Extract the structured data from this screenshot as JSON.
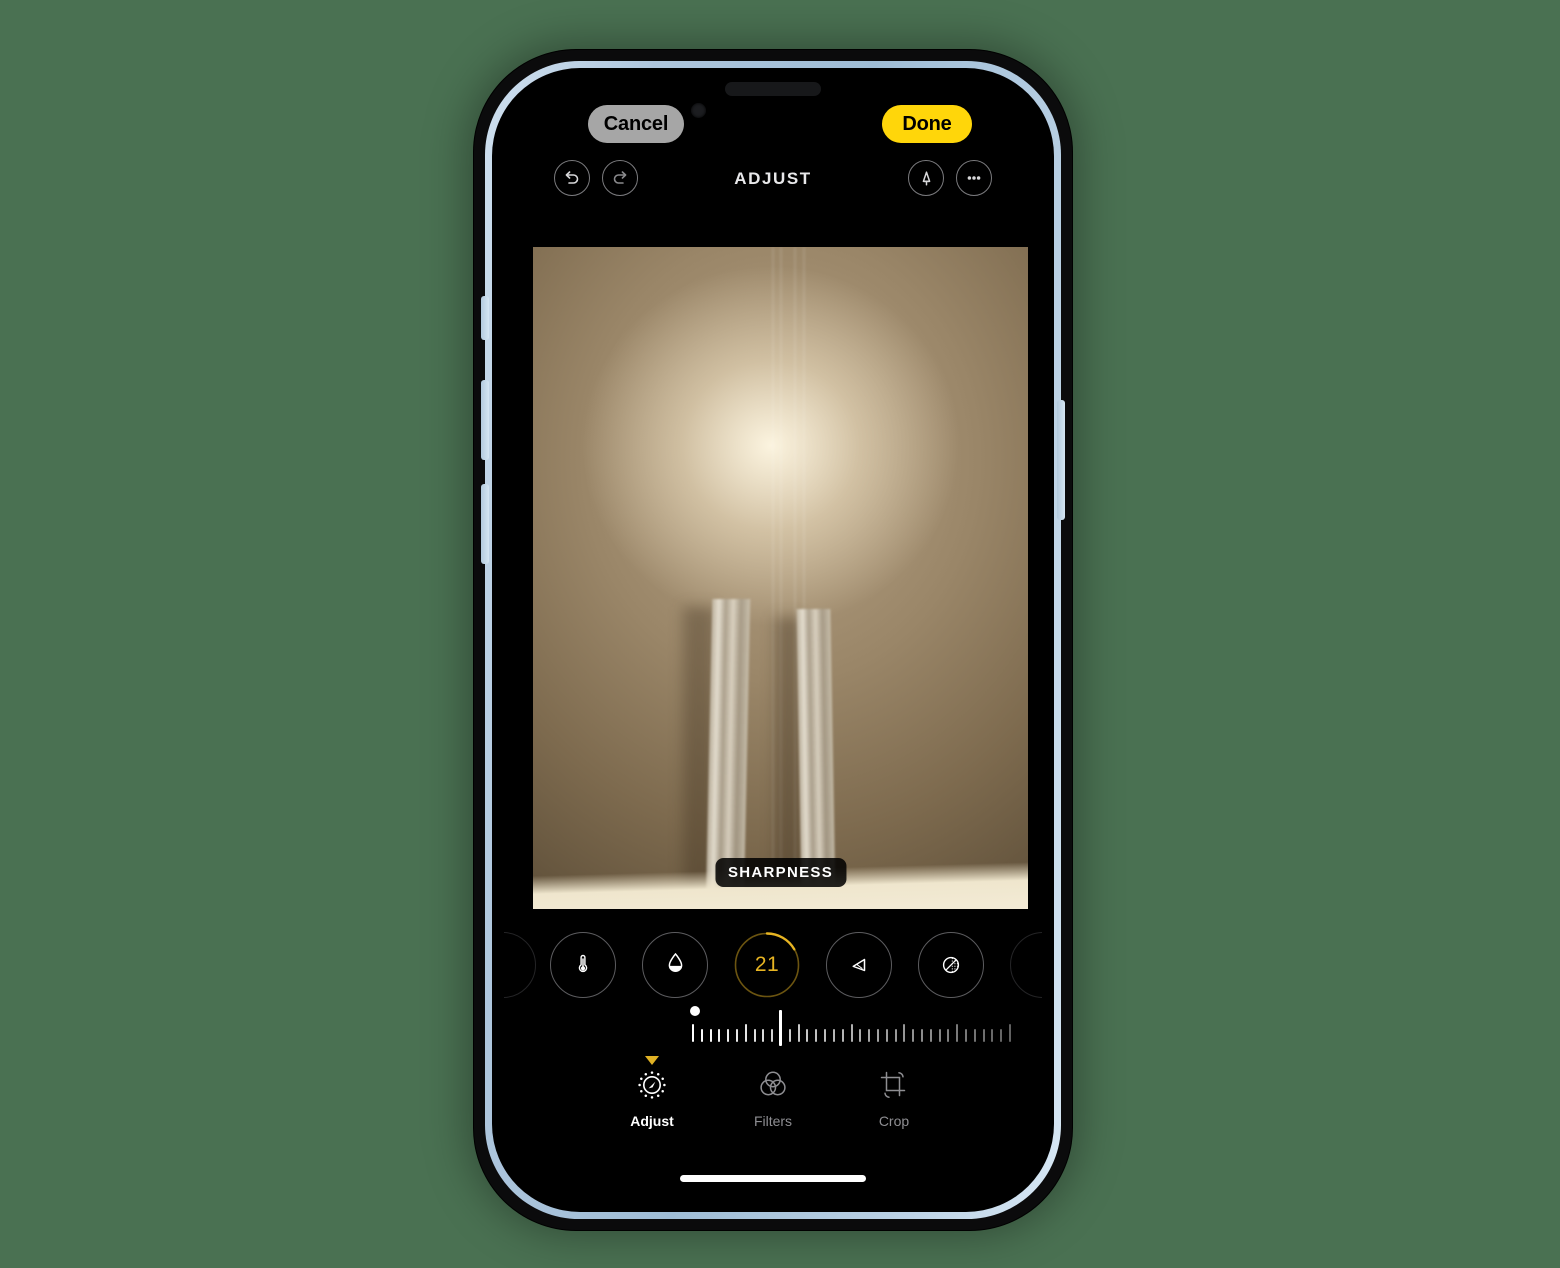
{
  "background_color": "#4a7152",
  "device": {
    "name": "iphone-frame",
    "frame_color": "#b9d0e4",
    "body_color": "#0b0b0c"
  },
  "top_bar": {
    "cancel_label": "Cancel",
    "done_label": "Done",
    "cancel_bg": "#a6a6a6",
    "done_bg": "#ffd60a"
  },
  "nav_bar": {
    "title": "ADJUST",
    "undo_icon": "undo-arrow-icon",
    "redo_icon": "redo-arrow-icon",
    "markup_icon": "markup-pen-icon",
    "more_icon": "more-ellipsis-icon"
  },
  "photo": {
    "overlay_label": "SHARPNESS",
    "description": "blurred warm-toned cabinet surface with two vertical metal handles"
  },
  "adjust_tools": {
    "items": [
      {
        "name": "tool-edge-left",
        "icon": "partial-circle-icon",
        "label": "",
        "active": false,
        "value": null
      },
      {
        "name": "tool-warmth",
        "icon": "thermometer-icon",
        "label": "Warmth",
        "active": false,
        "value": null
      },
      {
        "name": "tool-tint",
        "icon": "droplet-icon",
        "label": "Tint",
        "active": false,
        "value": null
      },
      {
        "name": "tool-sharpness",
        "icon": "value-ring-icon",
        "label": "Sharpness",
        "active": true,
        "value": "21"
      },
      {
        "name": "tool-definition",
        "icon": "triangle-definition-icon",
        "label": "Definition",
        "active": false,
        "value": null
      },
      {
        "name": "tool-noise-reduction",
        "icon": "noise-reduction-icon",
        "label": "Noise Reduction",
        "active": false,
        "value": null
      },
      {
        "name": "tool-edge-right",
        "icon": "partial-circle-icon",
        "label": "",
        "active": false,
        "value": null
      }
    ],
    "selected_value": "21",
    "selected_accent": "#e7b422"
  },
  "slider": {
    "name": "sharpness-slider",
    "value": 21,
    "min": 0,
    "max": 100,
    "tick_count": 37
  },
  "tabs": [
    {
      "name": "tab-adjust",
      "label": "Adjust",
      "icon": "adjust-dial-icon",
      "selected": true
    },
    {
      "name": "tab-filters",
      "label": "Filters",
      "icon": "filters-circles-icon",
      "selected": false
    },
    {
      "name": "tab-crop",
      "label": "Crop",
      "icon": "crop-icon",
      "selected": false
    }
  ],
  "home_indicator": "home-indicator-bar"
}
